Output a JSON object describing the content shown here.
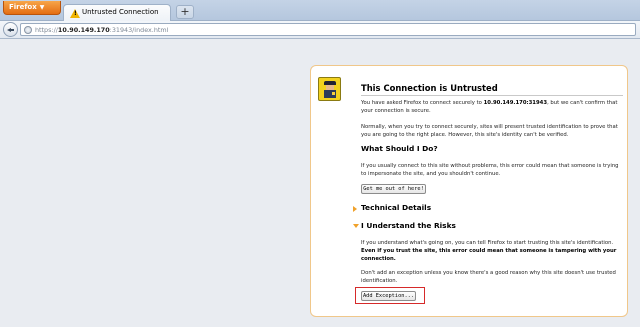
{
  "browser": {
    "app_button_label": "Firefox",
    "tab_title": "Untrusted Connection",
    "new_tab_label": "+"
  },
  "navbar": {
    "url_scheme": "https://",
    "url_host": "10.90.149.170",
    "url_rest": ":31943/index.html"
  },
  "page": {
    "title": "This Connection is Untrusted",
    "intro_prefix": "You have asked Firefox to connect securely to ",
    "intro_host": "10.90.149.170:31943",
    "intro_suffix": ", but we can't confirm that your connection is secure.",
    "intro_2": "Normally, when you try to connect securely, sites will present trusted identification to prove that you are going to the right place. However, this site's identity can't be verified.",
    "what_heading": "What Should I Do?",
    "what_text": "If you usually connect to this site without problems, this error could mean that someone is trying to impersonate the site, and you shouldn't continue.",
    "get_out_button": "Get me out of here!",
    "technical_heading": "Technical Details",
    "risks_heading": "I Understand the Risks",
    "risks_text_1": "If you understand what's going on, you can tell Firefox to start trusting this site's identification. ",
    "risks_text_1_bold": "Even if you trust the site, this error could mean that someone is tampering with your connection.",
    "risks_text_2": "Don't add an exception unless you know there's a good reason why this site doesn't use trusted identification.",
    "add_exception_button": "Add Exception..."
  },
  "colors": {
    "accent_orange": "#f0a12a",
    "highlight_red": "#d62a2a"
  }
}
